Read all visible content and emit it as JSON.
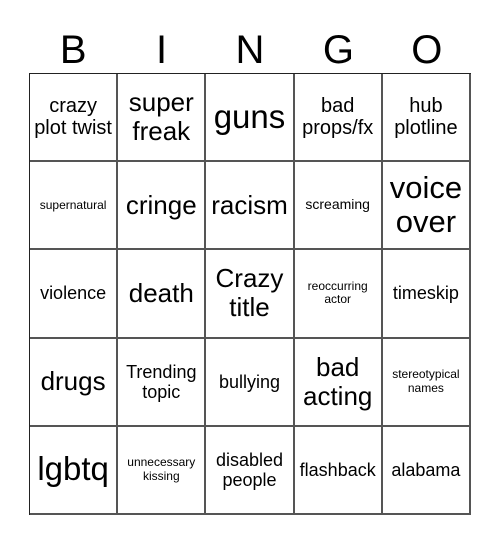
{
  "header": {
    "letters": [
      "B",
      "I",
      "N",
      "G",
      "O"
    ]
  },
  "cells": [
    "crazy plot twist",
    "super freak",
    "guns",
    "bad props/fx",
    "hub plotline",
    "supernatural",
    "cringe",
    "racism",
    "screaming",
    "voice over",
    "violence",
    "death",
    "Crazy title",
    "reoccurring actor",
    "timeskip",
    "drugs",
    "Trending topic",
    "bullying",
    "bad acting",
    "stereotypical names",
    "lgbtq",
    "unnecessary kissing",
    "disabled people",
    "flashback",
    "alabama"
  ]
}
